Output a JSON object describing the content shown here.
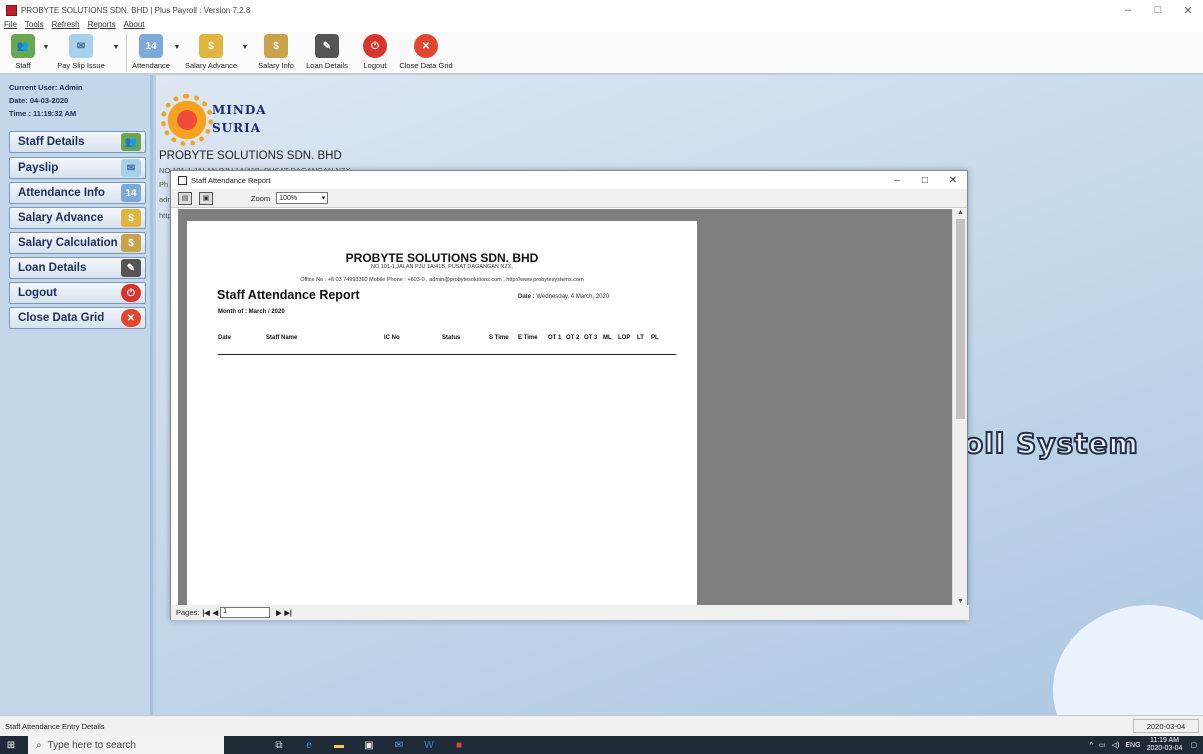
{
  "window": {
    "title": "PROBYTE SOLUTIONS SDN. BHD | Plus Payroll : Version 7.2.8",
    "controls": {
      "minimize": "–",
      "maximize": "□",
      "close": "✕"
    }
  },
  "menu": [
    "File",
    "Tools",
    "Refresh",
    "Reports",
    "About"
  ],
  "toolbar": {
    "staff": "Staff",
    "pay_slip_issue": "Pay Slip Issue",
    "attendance": "Attendance",
    "salary_advance": "Salary Advance",
    "salary_info": "Salary Info",
    "loan_details": "Loan Details",
    "logout": "Logout",
    "close_data_grid": "Close Data Grid"
  },
  "sidebar": {
    "current_user": "Current User: Admin",
    "date": "Date: 04-03-2020",
    "time": "Time : 11:19:32 AM",
    "items": [
      {
        "label": "Staff Details",
        "icon": "staff-icon"
      },
      {
        "label": "Payslip",
        "icon": "payslip-icon"
      },
      {
        "label": "Attendance Info",
        "icon": "calendar-icon"
      },
      {
        "label": "Salary Advance",
        "icon": "money-bag-icon"
      },
      {
        "label": "Salary Calculation",
        "icon": "money-sack-icon"
      },
      {
        "label": "Loan Details",
        "icon": "loan-form-icon"
      },
      {
        "label": "Logout",
        "icon": "power-icon"
      },
      {
        "label": "Close Data Grid",
        "icon": "close-circle-icon"
      }
    ]
  },
  "background": {
    "logo_line1": "MINDA",
    "logo_line2": "SURIA",
    "company": "PROBYTE SOLUTIONS  SDN. BHD",
    "address_partial": "NO.101-1 JALAN PJU 1A/41B, PUSAT DAGANGAN NZX",
    "phone_partial": "Ph",
    "email_partial": "adr",
    "web_partial": "http",
    "system_text": "oll System"
  },
  "report_window": {
    "title": "Staff Attendance Report",
    "zoom_label": "Zoom",
    "zoom_value": "100%",
    "pages_label": "Pages:",
    "page_value": "1",
    "controls": {
      "minimize": "–",
      "maximize": "□",
      "close": "✕"
    }
  },
  "report": {
    "company": "PROBYTE SOLUTIONS  SDN. BHD",
    "address": "NO.101-1,JALAN PJU 1A/41B, PUSAT DAGANGAN NZX,",
    "office": "Office No : +6 03 74993360 Mobile Phone : +603-0 , admin@probytesolutions.com , http://www.probytesystems.com",
    "title": "Staff Attendance Report",
    "date_label": "Date :",
    "date_value": "Wednesday, 4 March, 2020",
    "month": "Month of : March / 2020",
    "columns": [
      "Date",
      "Staff Name",
      "IC No",
      "Status",
      "S Time",
      "E Time",
      "OT 1",
      "OT 2",
      "OT 3",
      "ML",
      "LOP",
      "LT",
      "PL"
    ]
  },
  "statusbar": {
    "text": "Staff Attendance Entry Details",
    "date": "2020-03-04"
  },
  "taskbar": {
    "search_placeholder": "Type here to search",
    "lang": "ENG",
    "time": "11:19 AM",
    "date": "2020-03-04"
  },
  "colors": {
    "sidebar_text": "#1a2d5c",
    "accent_red": "#d9342b",
    "background_blue": "#c2d6ea"
  }
}
